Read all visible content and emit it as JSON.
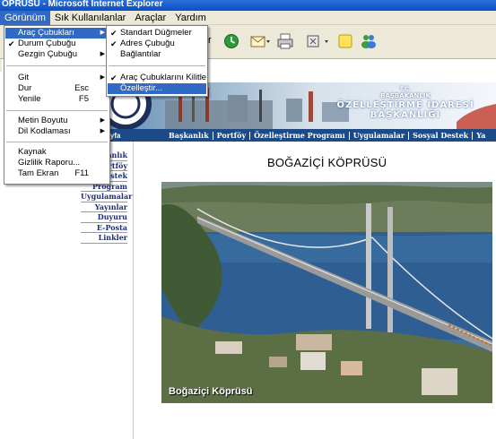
{
  "window": {
    "title": "ÖPRÜSÜ - Microsoft Internet Explorer"
  },
  "menubar": {
    "items": [
      {
        "label": "Görünüm",
        "active": true
      },
      {
        "label": "Sık Kullanılanlar",
        "active": false
      },
      {
        "label": "Araçlar",
        "active": false
      },
      {
        "label": "Yardım",
        "active": false
      }
    ]
  },
  "view_menu": {
    "items": [
      {
        "label": "Araç Çubukları",
        "submenu": true,
        "highlighted": true
      },
      {
        "label": "Durum Çubuğu",
        "checked": true
      },
      {
        "label": "Gezgin Çubuğu",
        "submenu": true
      },
      {
        "label": "Git",
        "submenu": true
      },
      {
        "label": "Dur",
        "shortcut": "Esc"
      },
      {
        "label": "Yenile",
        "shortcut": "F5"
      },
      {
        "label": "Metin Boyutu",
        "submenu": true
      },
      {
        "label": "Dil Kodlaması",
        "submenu": true
      },
      {
        "label": "Kaynak"
      },
      {
        "label": "Gizlilik Raporu..."
      },
      {
        "label": "Tam Ekran",
        "shortcut": "F11"
      }
    ]
  },
  "toolbars_submenu": {
    "items": [
      {
        "label": "Standart Düğmeler",
        "checked": true
      },
      {
        "label": "Adres Çubuğu",
        "checked": true
      },
      {
        "label": "Bağlantılar",
        "checked": false
      },
      {
        "label": "Araç Çubuklarını Kilitle",
        "checked": true
      },
      {
        "label": "Özelleştir...",
        "highlighted": true
      }
    ]
  },
  "toolbar": {
    "icons": [
      "history-icon",
      "mail-icon",
      "print-icon",
      "edit-icon",
      "discuss-icon",
      "messenger-icon"
    ],
    "partial_char": "r"
  },
  "banner": {
    "line1": "T.C.",
    "line2": "BAŞBAKANLIK",
    "line3": "ÖZELLEŞTİRME İDARESİ",
    "line4": "BAŞKANLIĞI"
  },
  "navbar": {
    "home": "Sayfa",
    "links": [
      "Başkanlık",
      "Portföy",
      "Özelleştirme Programı",
      "Uygulamalar",
      "Sosyal Destek",
      "Ya"
    ]
  },
  "sidebar": {
    "links": [
      "Başkanlık",
      "Portföy",
      "Destek",
      "Program",
      "Uygulamalar",
      "Yayınlar",
      "Duyuru",
      "E-Posta",
      "Linkler"
    ]
  },
  "main": {
    "title": "BOĞAZİÇİ KÖPRÜSÜ",
    "photo_caption": "Boğaziçi Köprüsü"
  },
  "colors": {
    "highlight": "#316ac5",
    "menubar_bg": "#ece9d8",
    "nav_bg": "#1b4a86"
  }
}
